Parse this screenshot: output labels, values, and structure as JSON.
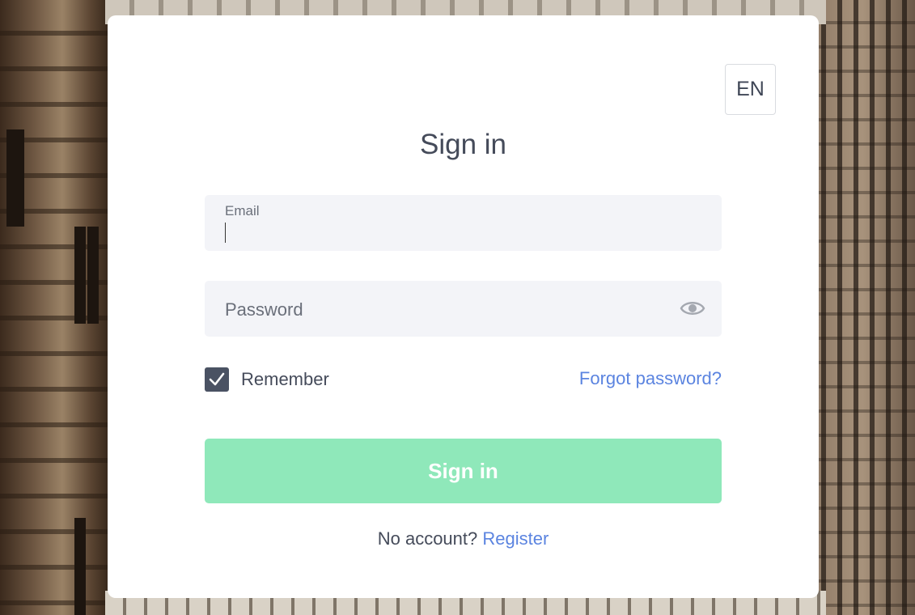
{
  "language": {
    "label": "EN"
  },
  "form": {
    "title": "Sign in",
    "email": {
      "label": "Email",
      "value": ""
    },
    "password": {
      "placeholder": "Password",
      "value": ""
    },
    "remember": {
      "label": "Remember",
      "checked": true
    },
    "forgot_link": "Forgot password?",
    "submit_label": "Sign in",
    "register_prompt": "No account?",
    "register_link": "Register"
  },
  "colors": {
    "accent_link": "#5b84e0",
    "submit_bg": "#8fe8ba",
    "field_bg": "#f3f4f8",
    "text": "#454b5a",
    "checkbox": "#4a5263"
  },
  "icons": {
    "password_toggle": "eye-icon",
    "checkbox": "checkmark-icon"
  }
}
